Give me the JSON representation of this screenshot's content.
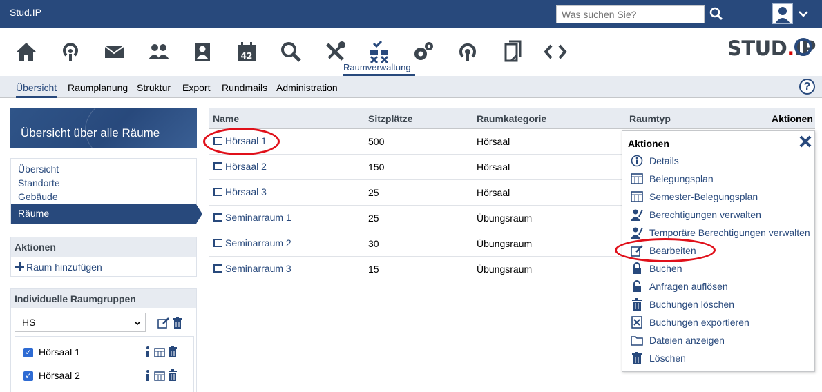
{
  "topbar": {
    "brand": "Stud.IP",
    "search_placeholder": "Was suchen Sie?"
  },
  "nav": {
    "active_label": "Raumverwaltung",
    "icons": [
      "home-icon",
      "community-icon",
      "mail-icon",
      "persons-icon",
      "profile-icon",
      "calendar-icon",
      "search-icon",
      "tools-icon",
      "room-admin-icon",
      "settings-icon",
      "reports-icon",
      "files-icon",
      "plugins-icon"
    ],
    "calendar_day": "42"
  },
  "logo": {
    "main": "STUD",
    "dot": ".",
    "tail": "IP"
  },
  "tabs": [
    "Übersicht",
    "Raumplanung",
    "Struktur",
    "Export",
    "Rundmails",
    "Administration"
  ],
  "help_label": "?",
  "sidebar": {
    "header": "Übersicht über alle Räume",
    "nav": [
      "Übersicht",
      "Standorte",
      "Gebäude",
      "Räume"
    ],
    "actions_title": "Aktionen",
    "add_room": "Raum hinzufügen",
    "groups_title": "Individuelle Raumgruppen",
    "group_select": "HS",
    "group_items": [
      {
        "label": "Hörsaal 1",
        "checked": true
      },
      {
        "label": "Hörsaal 2",
        "checked": true
      }
    ]
  },
  "table": {
    "columns": [
      "Name",
      "Sitzplätze",
      "Raumkategorie",
      "Raumtyp",
      "Aktionen"
    ],
    "rows": [
      {
        "name": "Hörsaal 1",
        "seats": "500",
        "category": "Hörsaal"
      },
      {
        "name": "Hörsaal 2",
        "seats": "150",
        "category": "Hörsaal"
      },
      {
        "name": "Hörsaal 3",
        "seats": "25",
        "category": "Hörsaal"
      },
      {
        "name": "Seminarraum 1",
        "seats": "25",
        "category": "Übungsraum"
      },
      {
        "name": "Seminarraum 2",
        "seats": "30",
        "category": "Übungsraum"
      },
      {
        "name": "Seminarraum 3",
        "seats": "15",
        "category": "Übungsraum"
      }
    ]
  },
  "popup": {
    "title": "Aktionen",
    "items": [
      {
        "label": "Details",
        "icon": "info-icon"
      },
      {
        "label": "Belegungsplan",
        "icon": "schedule-icon"
      },
      {
        "label": "Semester-Belegungsplan",
        "icon": "schedule-icon"
      },
      {
        "label": "Berechtigungen verwalten",
        "icon": "permissions-icon"
      },
      {
        "label": "Temporäre Berechtigungen verwalten",
        "icon": "permissions-icon"
      },
      {
        "label": "Bearbeiten",
        "icon": "edit-icon"
      },
      {
        "label": "Buchen",
        "icon": "lock-icon"
      },
      {
        "label": "Anfragen auflösen",
        "icon": "unlock-icon"
      },
      {
        "label": "Buchungen löschen",
        "icon": "trash-icon"
      },
      {
        "label": "Buchungen exportieren",
        "icon": "export-icon"
      },
      {
        "label": "Dateien anzeigen",
        "icon": "folder-icon"
      },
      {
        "label": "Löschen",
        "icon": "trash-icon"
      }
    ]
  },
  "colors": {
    "primary": "#28497c",
    "highlight_ellipse": "#e0101a",
    "checkbox": "#2e6bd3"
  }
}
